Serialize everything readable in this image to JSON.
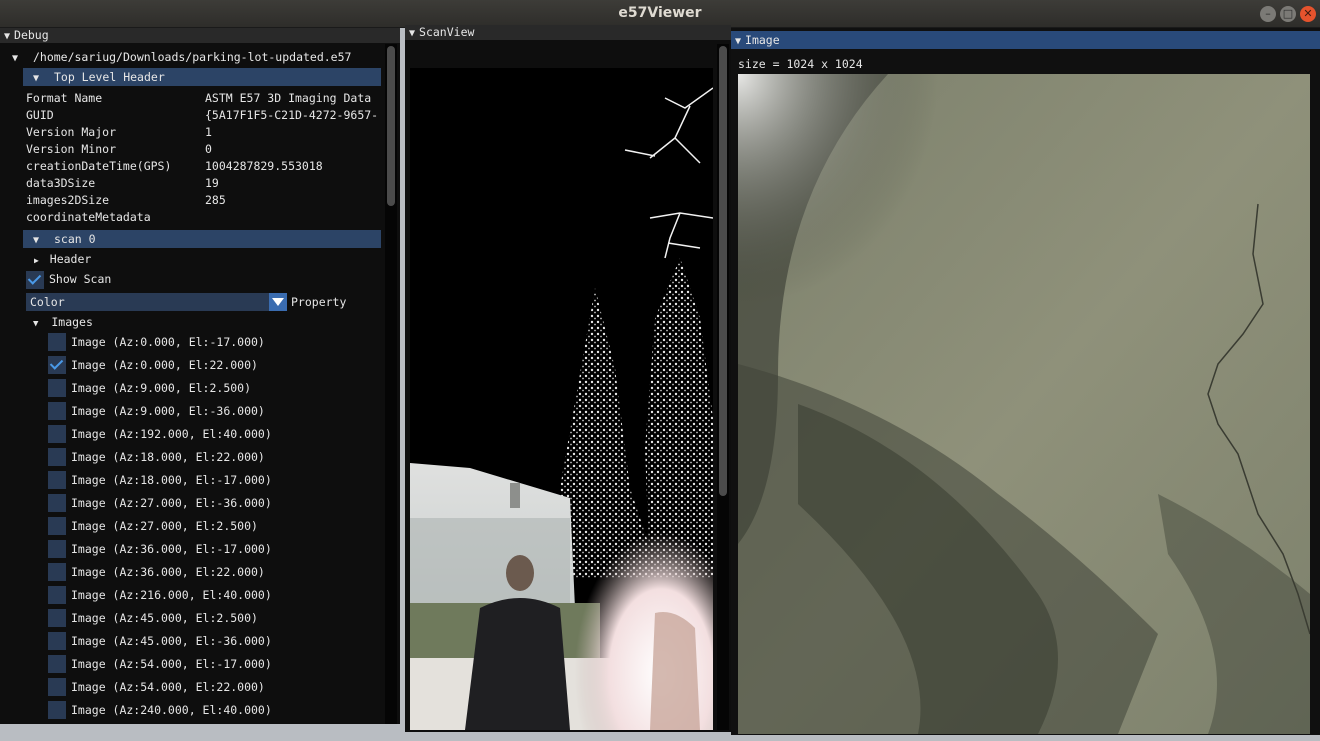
{
  "app": {
    "title": "e57Viewer",
    "minimize": "–",
    "maximize": "□",
    "close": "✕"
  },
  "debug": {
    "title": "Debug",
    "file_path": "/home/sariug/Downloads/parking-lot-updated.e57",
    "top_header": {
      "label": "Top Level Header",
      "fields": [
        {
          "key": "Format Name",
          "value": "ASTM E57 3D Imaging Data"
        },
        {
          "key": "GUID",
          "value": "{5A17F1F5-C21D-4272-9657-"
        },
        {
          "key": "Version Major",
          "value": "1"
        },
        {
          "key": "Version Minor",
          "value": "0"
        },
        {
          "key": "creationDateTime(GPS)",
          "value": "1004287829.553018"
        },
        {
          "key": "data3DSize",
          "value": "19"
        },
        {
          "key": "images2DSize",
          "value": "285"
        },
        {
          "key": "coordinateMetadata",
          "value": ""
        }
      ]
    },
    "scan": {
      "label": "scan 0",
      "header_label": "Header",
      "show_scan_label": "Show Scan",
      "show_scan_checked": true,
      "color_value": "Color",
      "property_label": "Property",
      "images_label": "Images",
      "images": [
        {
          "label": "Image (Az:0.000, El:-17.000)",
          "checked": false
        },
        {
          "label": "Image (Az:0.000, El:22.000)",
          "checked": true
        },
        {
          "label": "Image (Az:9.000, El:2.500)",
          "checked": false
        },
        {
          "label": "Image (Az:9.000, El:-36.000)",
          "checked": false
        },
        {
          "label": "Image (Az:192.000, El:40.000)",
          "checked": false
        },
        {
          "label": "Image (Az:18.000, El:22.000)",
          "checked": false
        },
        {
          "label": "Image (Az:18.000, El:-17.000)",
          "checked": false
        },
        {
          "label": "Image (Az:27.000, El:-36.000)",
          "checked": false
        },
        {
          "label": "Image (Az:27.000, El:2.500)",
          "checked": false
        },
        {
          "label": "Image (Az:36.000, El:-17.000)",
          "checked": false
        },
        {
          "label": "Image (Az:36.000, El:22.000)",
          "checked": false
        },
        {
          "label": "Image (Az:216.000, El:40.000)",
          "checked": false
        },
        {
          "label": "Image (Az:45.000, El:2.500)",
          "checked": false
        },
        {
          "label": "Image (Az:45.000, El:-36.000)",
          "checked": false
        },
        {
          "label": "Image (Az:54.000, El:-17.000)",
          "checked": false
        },
        {
          "label": "Image (Az:54.000, El:22.000)",
          "checked": false
        },
        {
          "label": "Image (Az:240.000, El:40.000)",
          "checked": false
        }
      ]
    }
  },
  "scanview": {
    "title": "ScanView"
  },
  "image": {
    "title": "Image",
    "size_text": "size = 1024 x 1024"
  },
  "colors": {
    "accent": "#294a7a",
    "header": "#2c4466",
    "checkbox": "#293a54",
    "check": "#4a9ae8"
  }
}
